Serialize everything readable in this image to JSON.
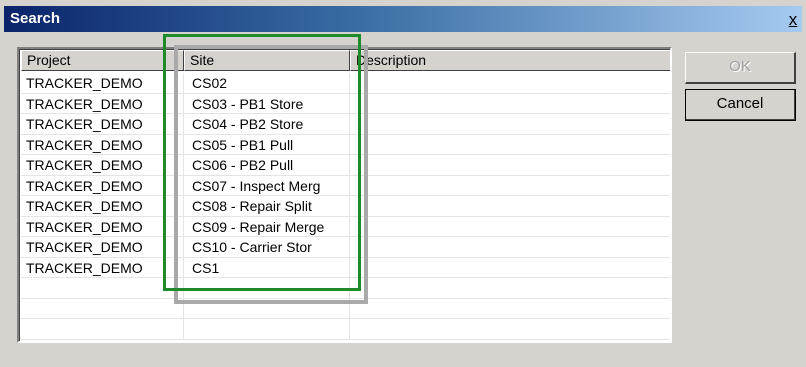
{
  "window": {
    "title": "Search",
    "close_label": "x"
  },
  "columns": [
    "Project",
    "Site",
    "Description"
  ],
  "rows": [
    {
      "project": "TRACKER_DEMO",
      "site": "CS02",
      "description": ""
    },
    {
      "project": "TRACKER_DEMO",
      "site": "CS03 - PB1 Store",
      "description": ""
    },
    {
      "project": "TRACKER_DEMO",
      "site": "CS04 - PB2 Store",
      "description": ""
    },
    {
      "project": "TRACKER_DEMO",
      "site": "CS05 - PB1 Pull",
      "description": ""
    },
    {
      "project": "TRACKER_DEMO",
      "site": "CS06 - PB2 Pull",
      "description": ""
    },
    {
      "project": "TRACKER_DEMO",
      "site": "CS07 - Inspect Merg",
      "description": ""
    },
    {
      "project": "TRACKER_DEMO",
      "site": "CS08 - Repair Split",
      "description": ""
    },
    {
      "project": "TRACKER_DEMO",
      "site": "CS09 - Repair Merge",
      "description": ""
    },
    {
      "project": "TRACKER_DEMO",
      "site": "CS10 - Carrier Stor",
      "description": ""
    },
    {
      "project": "TRACKER_DEMO",
      "site": "CS1",
      "description": ""
    },
    {
      "project": "",
      "site": "",
      "description": ""
    },
    {
      "project": "",
      "site": "",
      "description": ""
    },
    {
      "project": "",
      "site": "",
      "description": ""
    }
  ],
  "buttons": {
    "ok_label": "OK",
    "cancel_label": "Cancel"
  },
  "colors": {
    "highlight_green": "#1f8a2a",
    "highlight_gray": "#a9a9a9",
    "titlebar_start": "#0a246a",
    "titlebar_end": "#a6caf0"
  }
}
